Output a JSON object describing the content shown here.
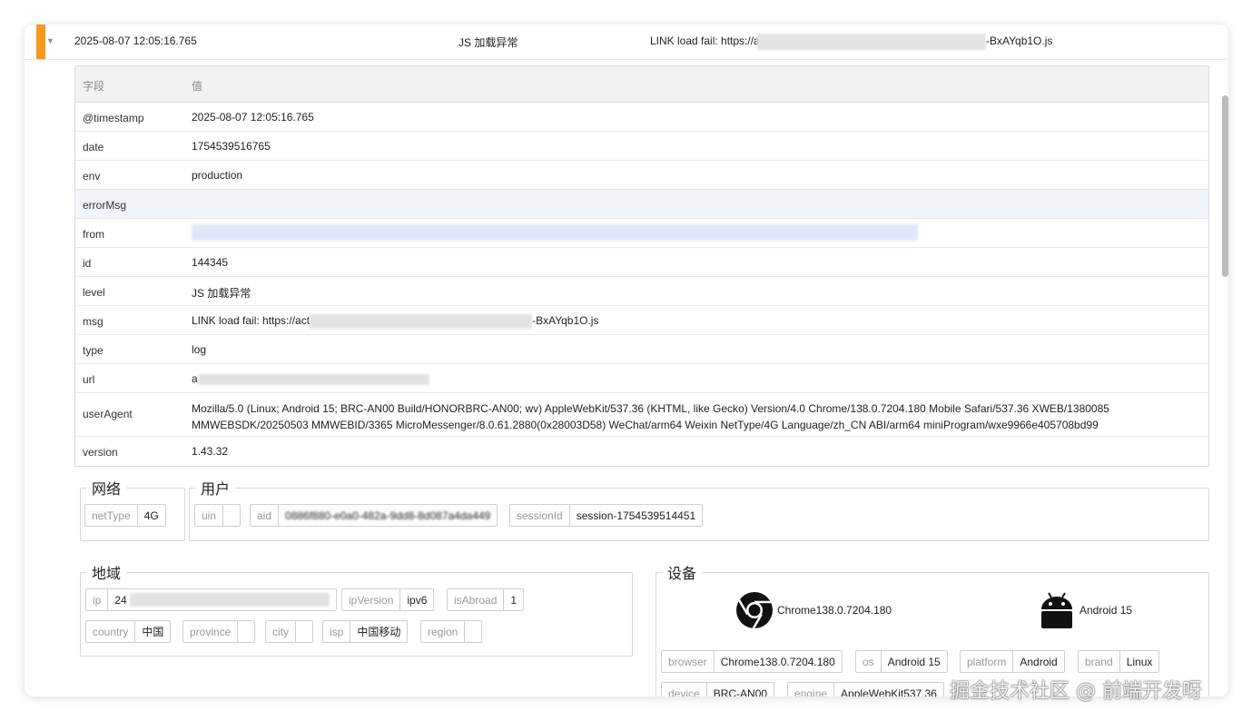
{
  "log_row": {
    "timestamp": "2025-08-07 12:05:16.765",
    "level": "JS 加载异常",
    "msg_prefix": "LINK load fail: https://a",
    "msg_suffix": "-BxAYqb1O.js"
  },
  "fields_table": {
    "headers": {
      "field": "字段",
      "value": "值"
    },
    "rows": {
      "timestamp": {
        "key": "@timestamp",
        "value": "2025-08-07 12:05:16.765"
      },
      "date": {
        "key": "date",
        "value": "1754539516765"
      },
      "env": {
        "key": "env",
        "value": "production"
      },
      "errorMsg": {
        "key": "errorMsg",
        "value": ""
      },
      "from": {
        "key": "from",
        "value": ""
      },
      "id": {
        "key": "id",
        "value": "144345"
      },
      "level": {
        "key": "level",
        "value": "JS 加载异常"
      },
      "msg": {
        "key": "msg",
        "value_prefix": "LINK load fail: https://act",
        "value_suffix": "-BxAYqb1O.js"
      },
      "type": {
        "key": "type",
        "value": "log"
      },
      "url": {
        "key": "url",
        "value": "a"
      },
      "userAgent": {
        "key": "userAgent",
        "value": "Mozilla/5.0 (Linux; Android 15; BRC-AN00 Build/HONORBRC-AN00; wv) AppleWebKit/537.36 (KHTML, like Gecko) Version/4.0 Chrome/138.0.7204.180 Mobile Safari/537.36 XWEB/1380085 MMWEBSDK/20250503 MMWEBID/3365 MicroMessenger/8.0.61.2880(0x28003D58) WeChat/arm64 Weixin NetType/4G Language/zh_CN ABI/arm64 miniProgram/wxe9966e405708bd99"
      },
      "version": {
        "key": "version",
        "value": "1.43.32"
      }
    }
  },
  "network": {
    "legend": "网络",
    "netType": {
      "key": "netType",
      "value": "4G"
    }
  },
  "user": {
    "legend": "用户",
    "uin": {
      "key": "uin",
      "value": ""
    },
    "aid": {
      "key": "aid",
      "value": "0886f880-e0a0-482a-9dd8-8d087a4da449"
    },
    "sessionId": {
      "key": "sessionId",
      "value": "session-1754539514451"
    }
  },
  "region": {
    "legend": "地域",
    "ip": {
      "key": "ip",
      "value": "24"
    },
    "ipVersion": {
      "key": "ipVersion",
      "value": "ipv6"
    },
    "isAbroad": {
      "key": "isAbroad",
      "value": "1"
    },
    "country": {
      "key": "country",
      "value": "中国"
    },
    "province": {
      "key": "province",
      "value": ""
    },
    "city": {
      "key": "city",
      "value": ""
    },
    "isp": {
      "key": "isp",
      "value": "中国移动"
    },
    "region_field": {
      "key": "region",
      "value": ""
    }
  },
  "device": {
    "legend": "设备",
    "browser_summary": "Chrome138.0.7204.180",
    "os_summary": "Android 15",
    "browser": {
      "key": "browser",
      "value": "Chrome138.0.7204.180"
    },
    "os": {
      "key": "os",
      "value": "Android 15"
    },
    "platform": {
      "key": "platform",
      "value": "Android"
    },
    "brand": {
      "key": "brand",
      "value": "Linux"
    },
    "device_field": {
      "key": "device",
      "value": "BRC-AN00"
    },
    "engine": {
      "key": "engine",
      "value": "AppleWebKit537.36"
    },
    "icons": [
      "chrome-icon",
      "android-icon"
    ]
  },
  "watermark": "掘金技术社区 @ 前端开发呀",
  "colors": {
    "accent": "#f59a23",
    "highlight_row": "#f1f4f8"
  }
}
